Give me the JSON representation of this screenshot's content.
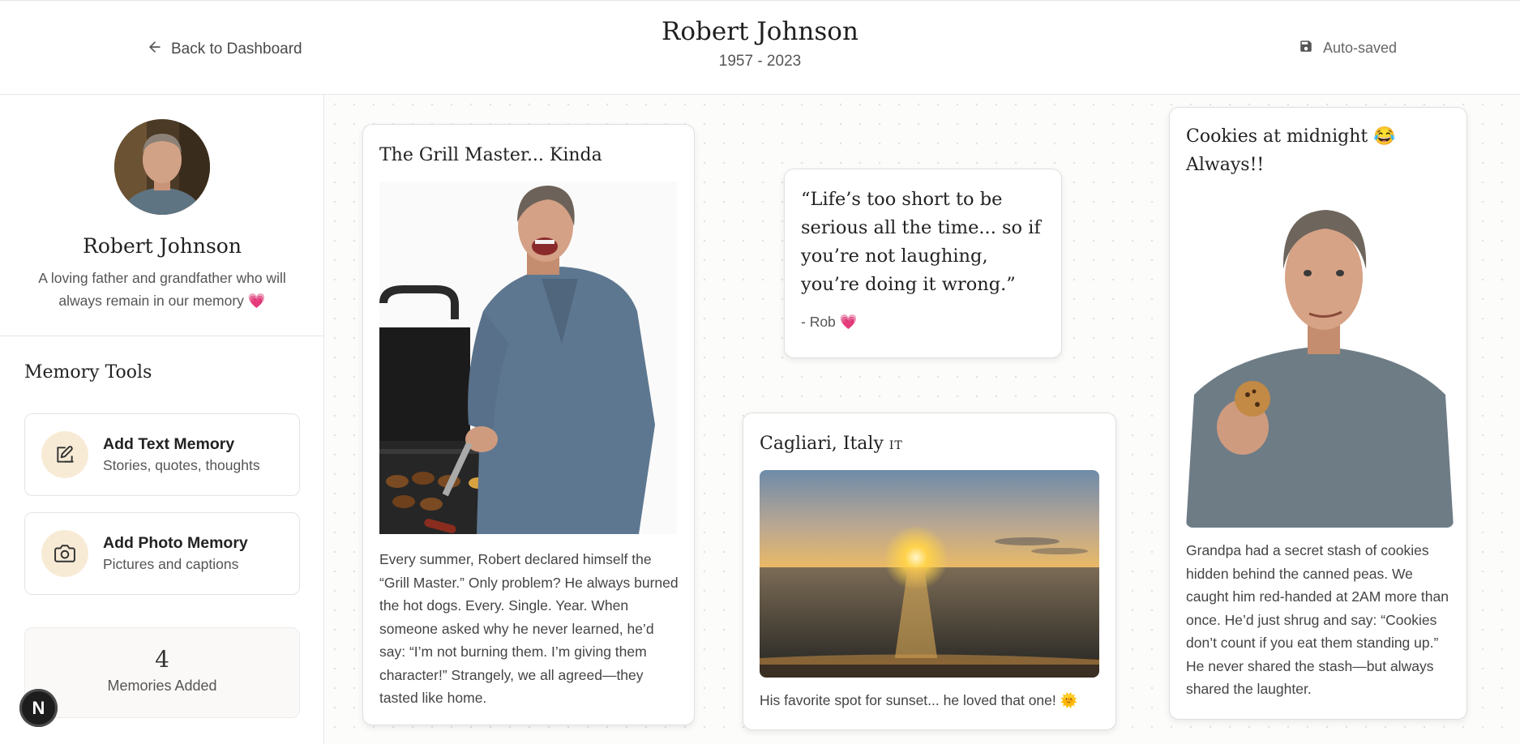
{
  "header": {
    "back_label": "Back to Dashboard",
    "title": "Robert Johnson",
    "dates": "1957 - 2023",
    "autosave_label": "Auto-saved"
  },
  "sidebar": {
    "profile": {
      "name": "Robert Johnson",
      "bio": "A loving father and grandfather who will always remain in our memory",
      "bio_emoji": "💗"
    },
    "tools_title": "Memory Tools",
    "tools": [
      {
        "title": "Add Text Memory",
        "subtitle": "Stories, quotes, thoughts",
        "icon": "edit-icon"
      },
      {
        "title": "Add Photo Memory",
        "subtitle": "Pictures and captions",
        "icon": "camera-icon"
      }
    ],
    "stats": {
      "count": "4",
      "label": "Memories Added"
    }
  },
  "badge": {
    "letter": "N"
  },
  "memories": {
    "grill": {
      "title": "The Grill Master... Kinda",
      "text": "Every summer, Robert declared himself the “Grill Master.” Only problem? He always burned the hot dogs. Every. Single. Year. When someone asked why he never learned, he’d say: “I’m not burning them. I’m giving them character!” Strangely, we all agreed—they tasted like home."
    },
    "quote": {
      "text": "“Life’s too short to be serious all the time... so if you’re not laughing, you’re doing it wrong.”",
      "author": "- Rob",
      "author_emoji": "💗"
    },
    "italy": {
      "title": "Cagliari, Italy",
      "flag": "IT",
      "caption": "His favorite spot for sunset... he loved that one!",
      "caption_emoji": "🌞"
    },
    "cookies": {
      "title": "Cookies at midnight",
      "title_emoji": "😂",
      "title_suffix": "Always!!",
      "text": "Grandpa had a secret stash of cookies hidden behind the canned peas. We caught him red-handed at 2AM more than once. He’d just shrug and say: “Cookies don’t count if you eat them standing up.” He never shared the stash—but always shared the laughter."
    }
  }
}
